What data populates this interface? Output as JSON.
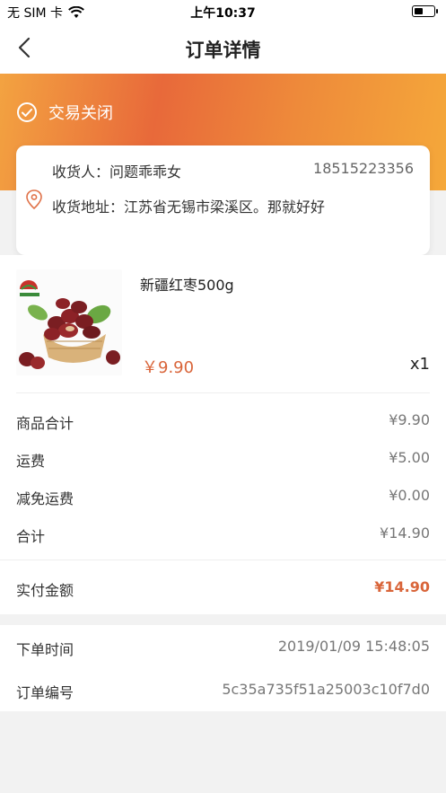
{
  "status_bar": {
    "carrier": "无 SIM 卡",
    "time": "上午10:37"
  },
  "nav": {
    "title": "订单详情"
  },
  "order_status": {
    "label": "交易关闭"
  },
  "address": {
    "receiver_label": "收货人：问题乖乖女",
    "phone": "18515223356",
    "address_label": "收货地址：江苏省无锡市梁溪区。那就好好"
  },
  "product": {
    "name": "新疆红枣500g",
    "price": "￥9.90",
    "quantity": "x1",
    "image_icon": "red-dates-image"
  },
  "summary": {
    "rows": [
      {
        "label": "商品合计",
        "value": "¥9.90"
      },
      {
        "label": "运费",
        "value": "¥5.00"
      },
      {
        "label": "减免运费",
        "value": "¥0.00"
      },
      {
        "label": "合计",
        "value": "¥14.90"
      }
    ],
    "paid_label": "实付金额",
    "paid_value": "¥14.90"
  },
  "order_info": {
    "time_label": "下单时间",
    "time_value": "2019/01/09 15:48:05",
    "number_label": "订单编号",
    "number_value": "5c35a735f51a25003c10f7d0"
  },
  "colors": {
    "accent": "#d9653a",
    "banner_start": "#f3a341",
    "banner_mid": "#e8693a"
  }
}
